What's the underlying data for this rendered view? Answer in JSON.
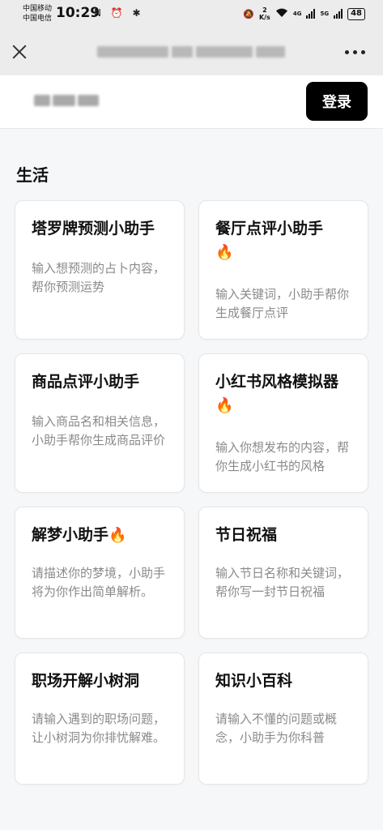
{
  "status_bar": {
    "carrier_1": "中国移动",
    "carrier_2": "中国电信",
    "time": "10:29",
    "left_icons": "N ⏰ ✱",
    "net_speed_value": "2",
    "net_speed_unit": "K/s",
    "net_1": "4G",
    "net_2": "5G",
    "battery": "48"
  },
  "title_bar": {
    "close_icon": "close-icon",
    "more_icon": "more-icon"
  },
  "user_bar": {
    "login_label": "登录"
  },
  "section": {
    "title": "生活"
  },
  "cards": [
    {
      "title": "塔罗牌预测小助手",
      "hot": false,
      "desc": "输入想预测的占卜内容，帮你预测运势"
    },
    {
      "title": "餐厅点评小助手",
      "hot": true,
      "desc": "输入关键词，小助手帮你生成餐厅点评"
    },
    {
      "title": "商品点评小助手",
      "hot": false,
      "desc": "输入商品名和相关信息，小助手帮你生成商品评价"
    },
    {
      "title": "小红书风格模拟器",
      "hot": true,
      "desc": "输入你想发布的内容，帮你生成小红书的风格"
    },
    {
      "title": "解梦小助手",
      "hot": true,
      "desc": "请描述你的梦境，小助手将为你作出简单解析。"
    },
    {
      "title": "节日祝福",
      "hot": false,
      "desc": "输入节日名称和关键词，帮你写一封节日祝福"
    },
    {
      "title": "职场开解小树洞",
      "hot": false,
      "desc": "请输入遇到的职场问题，让小树洞为你排忧解难。"
    },
    {
      "title": "知识小百科",
      "hot": false,
      "desc": "请输入不懂的问题或概念，小助手为你科普"
    }
  ],
  "hot_icon": "fire-icon",
  "hot_glyph": "🔥"
}
